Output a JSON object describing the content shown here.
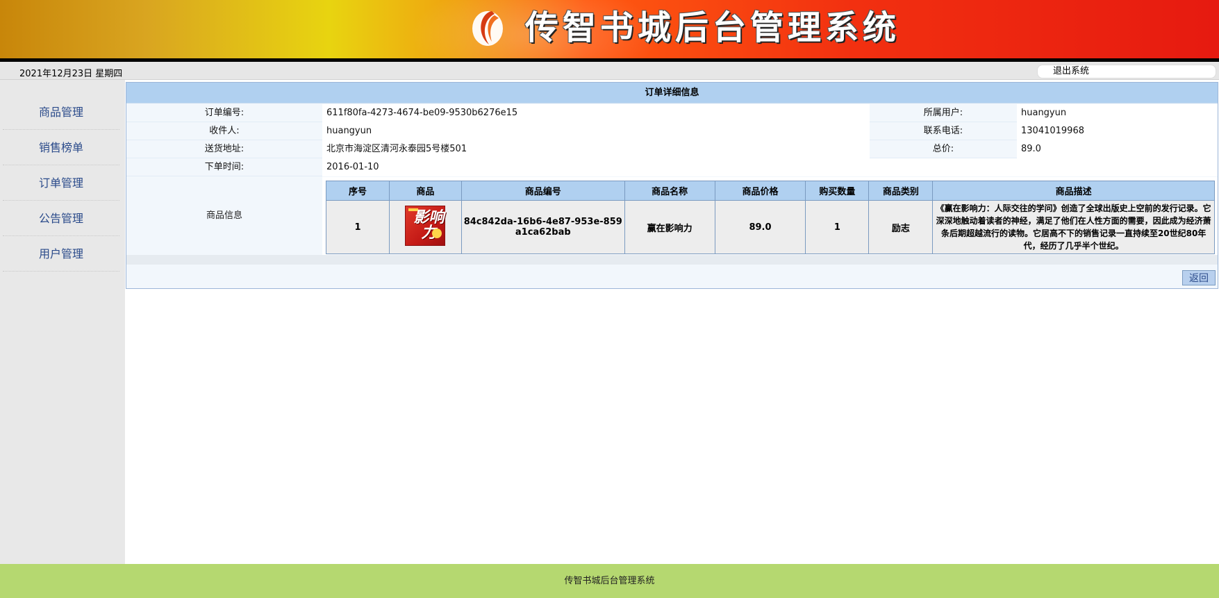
{
  "header": {
    "title": "传智书城后台管理系统",
    "logo_icon": "ribbon-logo-icon"
  },
  "infobar": {
    "date": "2021年12月23日 星期四",
    "logout_label": "退出系统"
  },
  "sidebar": {
    "items": [
      {
        "label": "商品管理"
      },
      {
        "label": "销售榜单"
      },
      {
        "label": "订单管理"
      },
      {
        "label": "公告管理"
      },
      {
        "label": "用户管理"
      }
    ]
  },
  "order": {
    "title": "订单详细信息",
    "labels": {
      "order_no": "订单编号:",
      "user": "所属用户:",
      "receiver": "收件人:",
      "phone": "联系电话:",
      "address": "送货地址:",
      "total": "总价:",
      "time": "下单时间:",
      "goods": "商品信息"
    },
    "values": {
      "order_no": "611f80fa-4273-4674-be09-9530b6276e15",
      "user": "huangyun",
      "receiver": "huangyun",
      "phone": "13041019968",
      "address": "北京市海淀区清河永泰园5号楼501",
      "total": "89.0",
      "time": "2016-01-10"
    },
    "goods_table": {
      "headers": [
        "序号",
        "商品",
        "商品编号",
        "商品名称",
        "商品价格",
        "购买数量",
        "商品类别",
        "商品描述"
      ],
      "rows": [
        {
          "index": "1",
          "image_text": "影响力",
          "id": "84c842da-16b6-4e87-953e-859a1ca62bab",
          "name": "赢在影响力",
          "price": "89.0",
          "quantity": "1",
          "category": "励志",
          "description": "《赢在影响力：人际交往的学问》创造了全球出版史上空前的发行记录。它深深地触动着读者的神经，满足了他们在人性方面的需要，因此成为经济萧条后期超越流行的读物。它居高不下的销售记录一直持续至20世纪80年代，经历了几乎半个世纪。"
        }
      ]
    },
    "back_label": "返回"
  },
  "footer": {
    "text": "传智书城后台管理系统"
  }
}
